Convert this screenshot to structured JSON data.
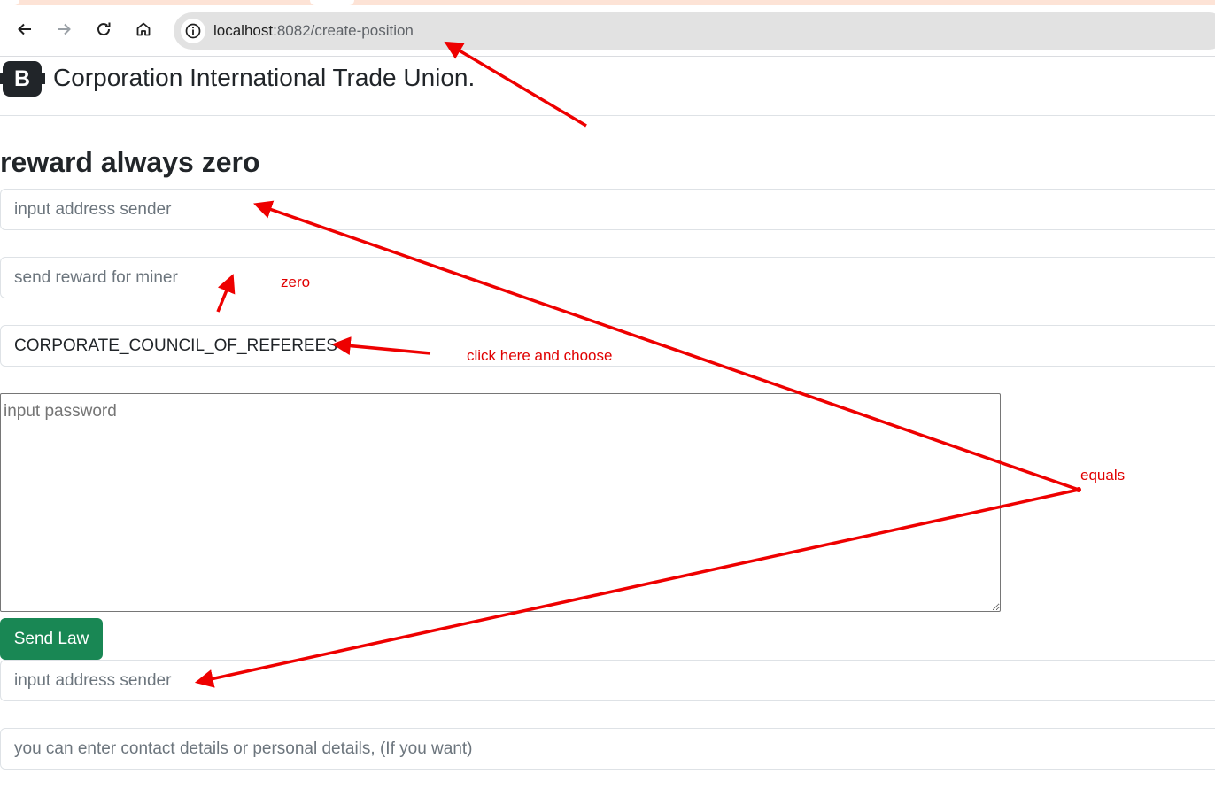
{
  "browser": {
    "url_host": "localhost",
    "url_rest": ":8082/create-position",
    "icons": [
      "back-arrow-icon",
      "forward-arrow-icon",
      "reload-icon",
      "home-icon",
      "info-icon"
    ]
  },
  "navbar": {
    "logo_letter": "B",
    "brand": "Corporation International Trade Union."
  },
  "page": {
    "heading": "reward always zero"
  },
  "form": {
    "sender_placeholder": "input address sender",
    "reward_placeholder": "send reward for miner",
    "position_selected": "CORPORATE_COUNCIL_OF_REFEREES",
    "password_placeholder": "input password",
    "submit_label": "Send Law",
    "sender2_placeholder": "input address sender",
    "details_placeholder": "you can enter contact details or personal details, (If you want)"
  },
  "annotations": {
    "zero": "zero",
    "choose": "click here and choose",
    "equals": "equals",
    "color": "#e00000"
  }
}
